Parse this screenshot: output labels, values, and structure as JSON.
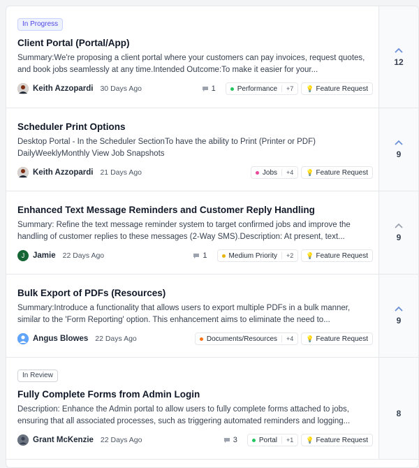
{
  "posts": [
    {
      "status": "In Progress",
      "title": "Client Portal (Portal/App)",
      "summary": "Summary:We're proposing a client portal where your customers can pay invoices, request quotes, and book jobs seamlessly at any time.Intended Outcome:To make it easier for your...",
      "author": "Keith Azzopardi",
      "date": "30 Days Ago",
      "comments": "1",
      "category": "Performance",
      "category_more": "+7",
      "type": "Feature Request",
      "votes": "12"
    },
    {
      "title": "Scheduler Print Options",
      "summary": "Desktop Portal - In the Scheduler SectionTo have the ability to Print (Printer or PDF) DailyWeeklyMonthly View Job Snapshots",
      "author": "Keith Azzopardi",
      "date": "21 Days Ago",
      "category": "Jobs",
      "category_more": "+4",
      "type": "Feature Request",
      "votes": "9"
    },
    {
      "title": "Enhanced Text Message Reminders and Customer Reply Handling",
      "summary": "Summary: Refine the text message reminder system to target confirmed jobs and improve the handling of customer replies to these messages (2-Way SMS).Description: At present, text...",
      "author": "Jamie",
      "avatar_initial": "J",
      "date": "22 Days Ago",
      "comments": "1",
      "category": "Medium Priority",
      "category_more": "+2",
      "type": "Feature Request",
      "votes": "9"
    },
    {
      "title": "Bulk Export of PDFs (Resources)",
      "summary": "Summary:Introduce a functionality that allows users to export multiple PDFs in a bulk manner, similar to the 'Form Reporting' option. This enhancement aims to eliminate the need to...",
      "author": "Angus Blowes",
      "date": "22 Days Ago",
      "category": "Documents/Resources",
      "category_more": "+4",
      "type": "Feature Request",
      "votes": "9"
    },
    {
      "status": "In Review",
      "title": "Fully Complete Forms from Admin Login",
      "summary": "Description: Enhance the Admin portal to allow users to fully complete forms attached to jobs, ensuring that all associated processes, such as triggering automated reminders and logging...",
      "author": "Grant McKenzie",
      "date": "22 Days Ago",
      "comments": "3",
      "category": "Portal",
      "category_more": "+1",
      "type": "Feature Request",
      "votes": "8"
    }
  ],
  "colors": {
    "performance": "#22c55e",
    "jobs": "#ec4899",
    "medium_priority": "#eab308",
    "documents": "#f97316",
    "portal": "#22c55e",
    "upvote_chevron": "#6b8fd6",
    "avatar_jamie": "#166534"
  },
  "icons": {
    "comment": "comment-icon",
    "upvote": "chevron-up-icon",
    "feature": "lightbulb-icon"
  }
}
